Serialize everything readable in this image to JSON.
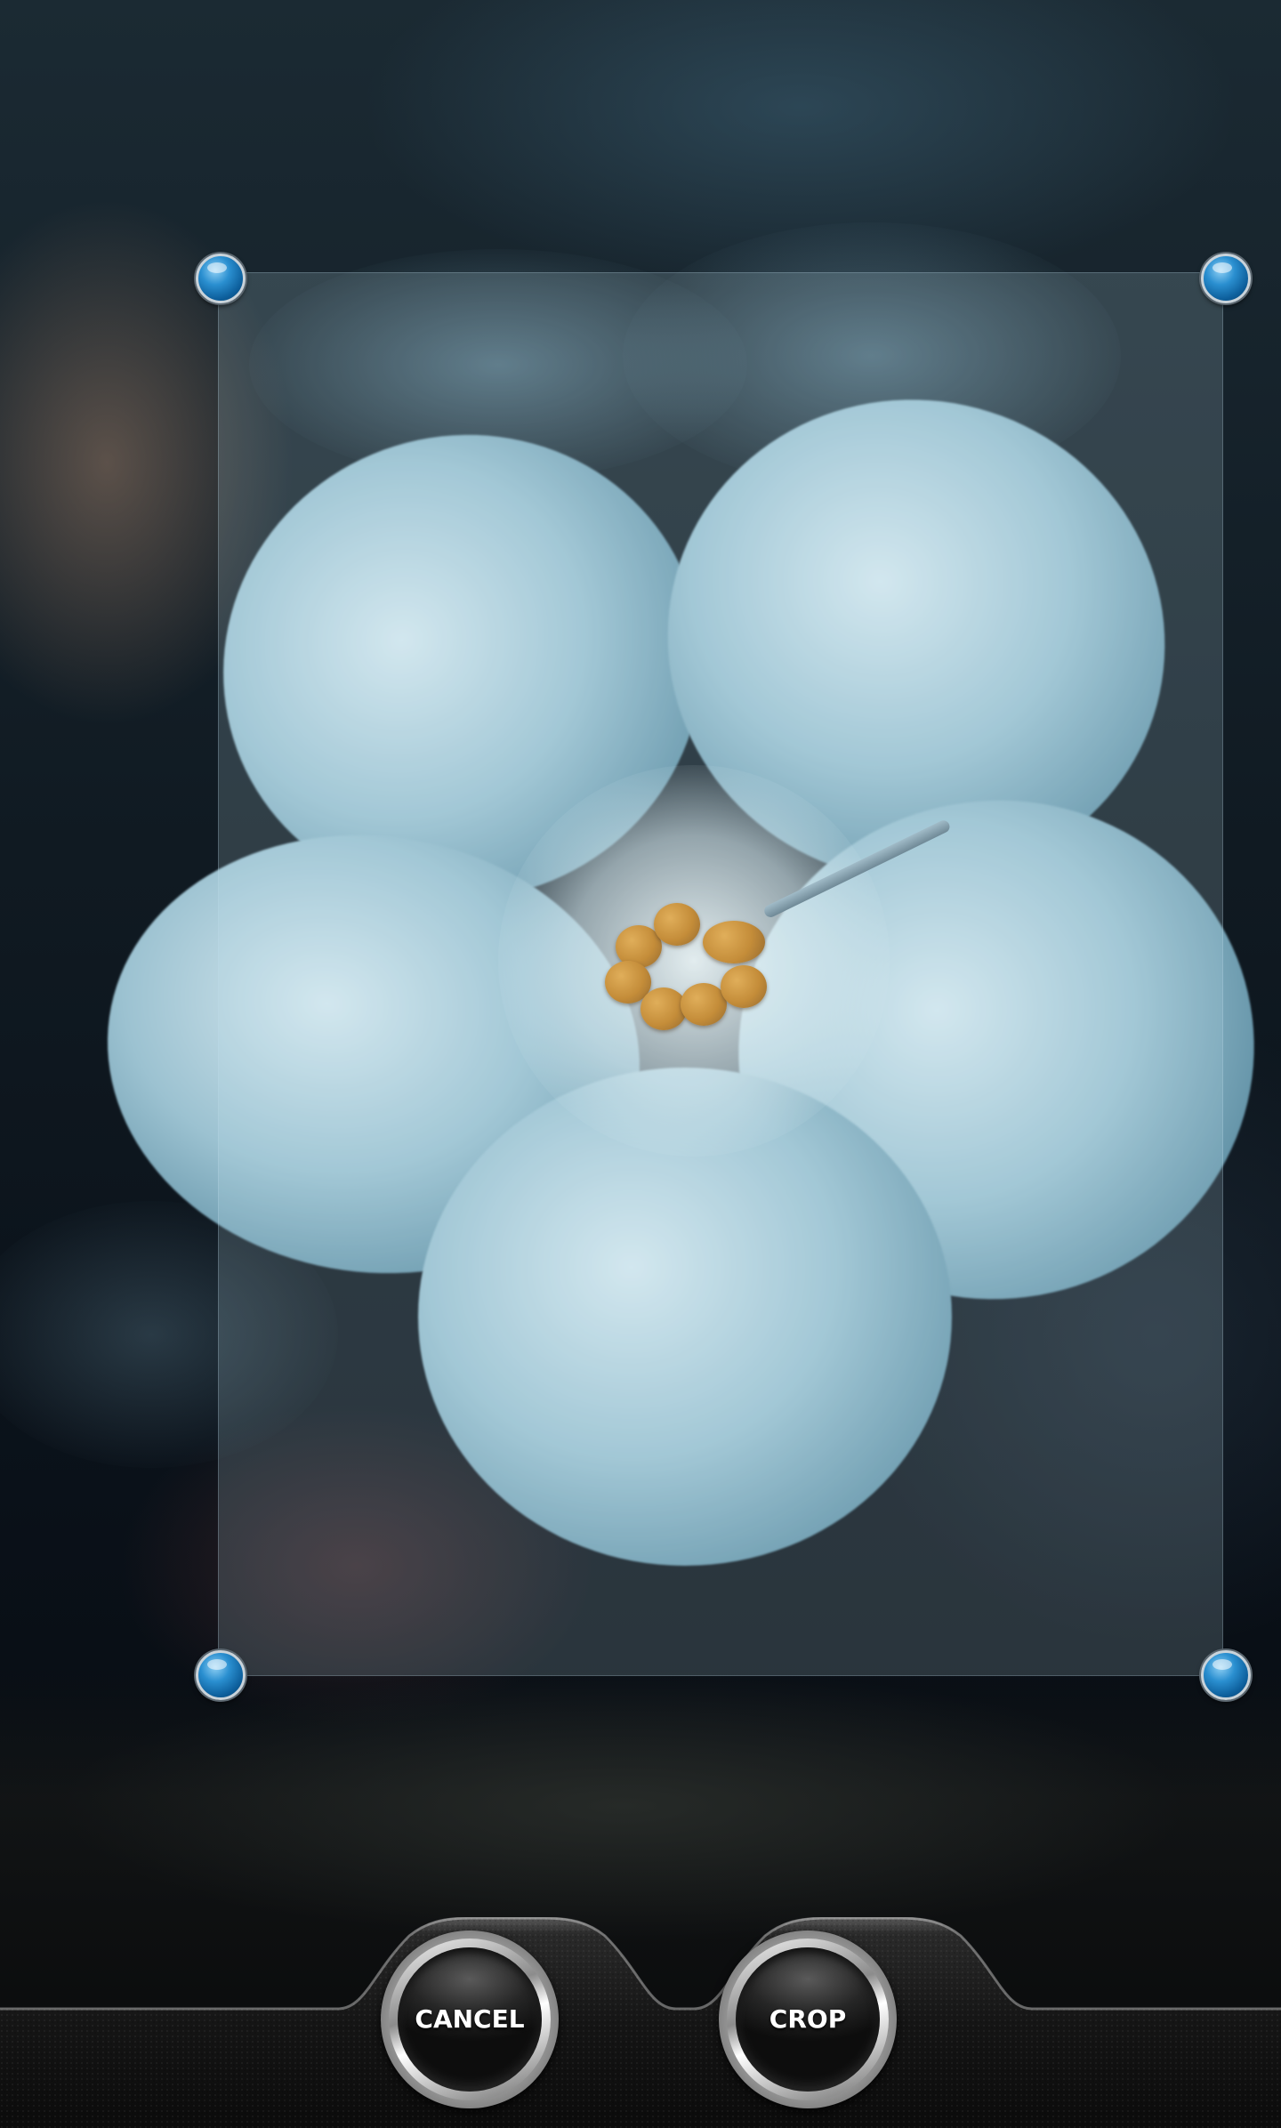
{
  "screen": {
    "name": "image-crop-screen"
  },
  "crop": {
    "handles": [
      "top-left",
      "top-right",
      "bottom-left",
      "bottom-right"
    ],
    "handle_color": "#1a7fc4"
  },
  "actions": {
    "cancel_label": "CANCEL",
    "crop_label": "CROP"
  },
  "icons": {
    "crop_handle": "circle-handle-icon"
  }
}
